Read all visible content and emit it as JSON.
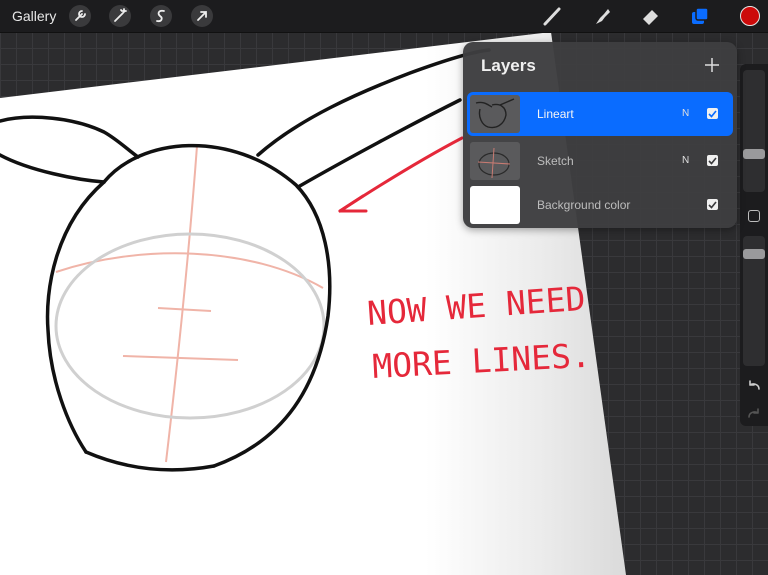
{
  "topbar": {
    "gallery_label": "Gallery",
    "left_tools": [
      "wrench-icon",
      "magic-wand-icon",
      "selection-icon",
      "transform-arrow-icon"
    ],
    "right_tools": [
      "brush-icon",
      "smudge-icon",
      "eraser-icon",
      "layers-icon"
    ],
    "current_color": "#cc0a0a"
  },
  "layers_panel": {
    "title": "Layers",
    "layers": [
      {
        "name": "Lineart",
        "blend_mode": "N",
        "visible": true,
        "active": true
      },
      {
        "name": "Sketch",
        "blend_mode": "N",
        "visible": true,
        "active": false
      },
      {
        "name": "Background color",
        "blend_mode": "",
        "visible": true,
        "active": false
      }
    ]
  },
  "annotation": {
    "handwritten_note": "Now we need more lines.",
    "ink_color": "#e5283a"
  },
  "colors": {
    "accent": "#0a6cff",
    "sketch_guides": "#f0b4a8"
  }
}
